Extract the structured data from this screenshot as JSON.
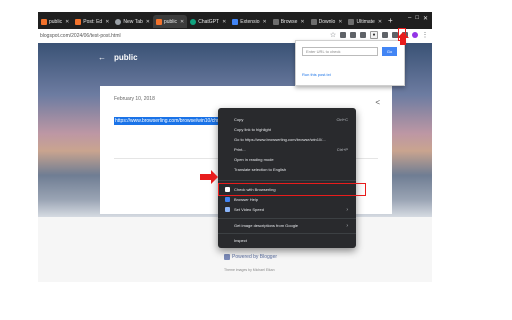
{
  "browser": {
    "tabs": [
      {
        "label": "public",
        "color": "#f3722c",
        "active": false
      },
      {
        "label": "Post: Ed",
        "color": "#f3722c",
        "active": false
      },
      {
        "label": "New Tab",
        "color": "#9aa0a6",
        "active": false
      },
      {
        "label": "public",
        "color": "#f3722c",
        "active": true
      },
      {
        "label": "ChatGPT",
        "color": "#10a37f",
        "active": false
      },
      {
        "label": "Extensio",
        "color": "#4285f4",
        "active": false
      },
      {
        "label": "Browse",
        "color": "#6d6d6d",
        "active": false
      },
      {
        "label": "Downlo",
        "color": "#6d6d6d",
        "active": false
      },
      {
        "label": "Ultimate",
        "color": "#6d6d6d",
        "active": false
      }
    ],
    "url": "blogspot.com/2024/06/test-post.html"
  },
  "page": {
    "title": "public",
    "post_date": "February 10, 2018",
    "link_text": "https://www.browserling.com/browse/win10/chrome127/",
    "powered_by": "Powered by Blogger",
    "theme_credit": "Theme images by Michael Elkan"
  },
  "popup": {
    "input_placeholder": "Enter URL to check",
    "button_label": "Go",
    "link_text": "Run this post.txt"
  },
  "context_menu": {
    "items": [
      {
        "label": "Copy",
        "shortcut": "Ctrl+C"
      },
      {
        "label": "Copy link to highlight",
        "shortcut": ""
      },
      {
        "label": "Go to https://www.browserling.com/browse/win10/...",
        "shortcut": ""
      },
      {
        "label": "Print...",
        "shortcut": "Ctrl+P"
      },
      {
        "label": "Open in reading mode",
        "shortcut": ""
      },
      {
        "label": "Translate selection to English",
        "shortcut": ""
      },
      {
        "label": "Check with Browserling",
        "shortcut": ""
      },
      {
        "label": "Browser Help",
        "shortcut": ""
      },
      {
        "label": "Set Video Speed",
        "shortcut": ""
      },
      {
        "label": "Get image descriptions from Google",
        "shortcut": ""
      },
      {
        "label": "Inspect",
        "shortcut": ""
      }
    ]
  },
  "colors": {
    "annotation": "#e81c1c",
    "selection": "#1a73e8",
    "menu_bg": "#292a2d"
  }
}
